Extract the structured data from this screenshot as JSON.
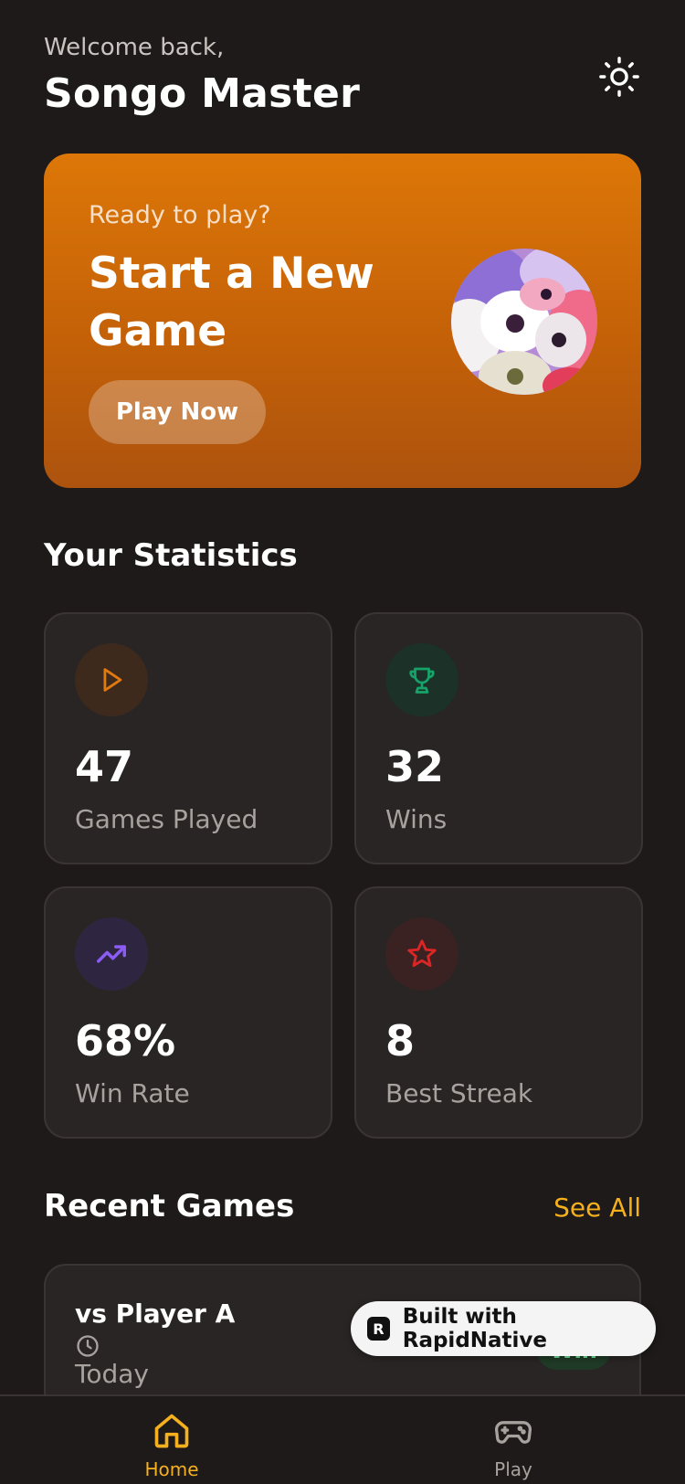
{
  "header": {
    "greeting": "Welcome back,",
    "username": "Songo Master",
    "theme_icon": "sun-icon"
  },
  "hero": {
    "kicker": "Ready to play?",
    "title": "Start a New Game",
    "button_label": "Play Now"
  },
  "stats": {
    "title": "Your Statistics",
    "cards": [
      {
        "value": "47",
        "label": "Games Played",
        "icon": "play-icon",
        "color": "#e07a10"
      },
      {
        "value": "32",
        "label": "Wins",
        "icon": "trophy-icon",
        "color": "#16a36a"
      },
      {
        "value": "68%",
        "label": "Win Rate",
        "icon": "trending-up-icon",
        "color": "#8b5cf6"
      },
      {
        "value": "8",
        "label": "Best Streak",
        "icon": "star-icon",
        "color": "#dc2626"
      }
    ]
  },
  "recent": {
    "title": "Recent Games",
    "see_all": "See All",
    "games": [
      {
        "opponent": "vs Player A",
        "date": "Today",
        "result": "Win"
      }
    ]
  },
  "badge": {
    "label": "Built with RapidNative"
  },
  "tabs": [
    {
      "label": "Home",
      "icon": "home-icon",
      "active": true
    },
    {
      "label": "Play",
      "icon": "gamepad-icon",
      "active": false
    }
  ],
  "colors": {
    "accent": "#f5b01e",
    "background": "#1d1a19",
    "card": "#292524",
    "hero": "#dd7708"
  }
}
